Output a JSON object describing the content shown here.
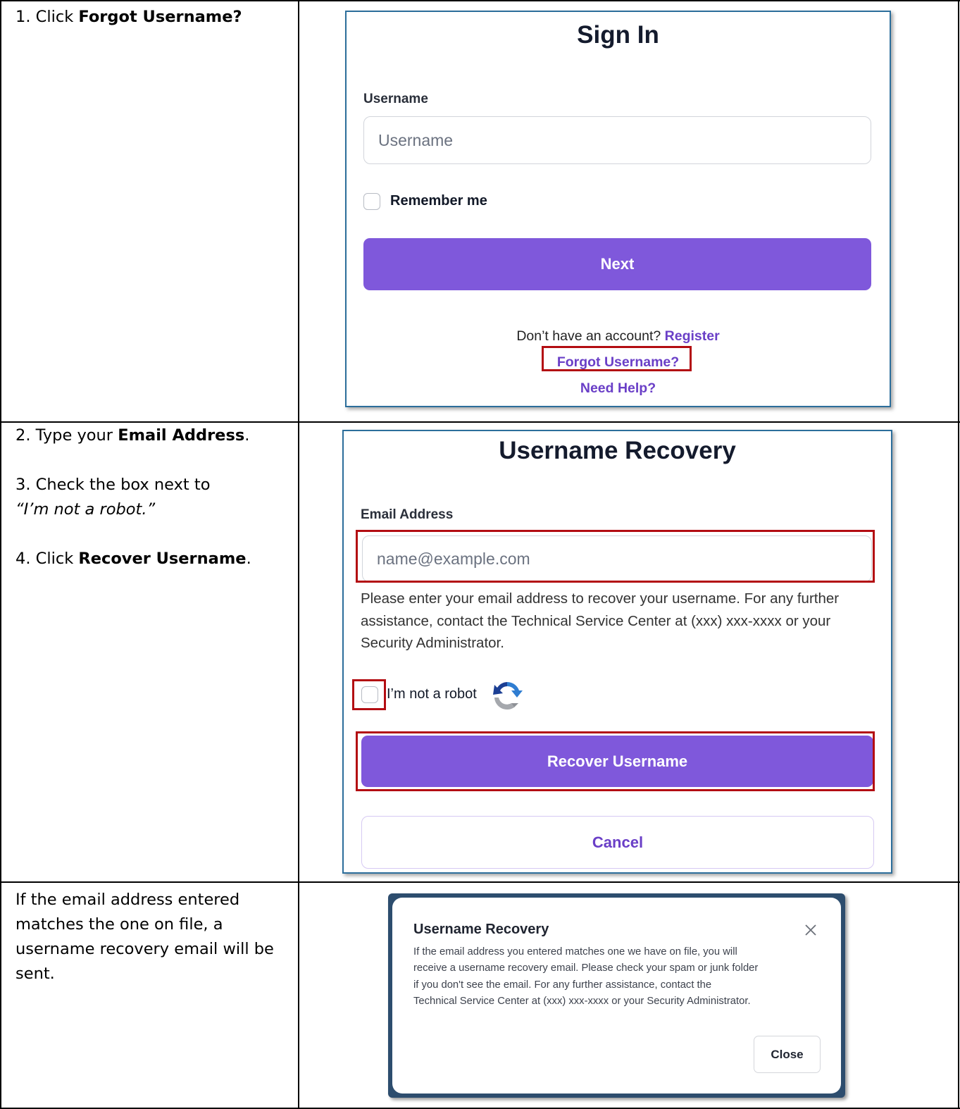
{
  "steps": {
    "step1": {
      "prefix": "1. Click ",
      "bold": "Forgot Username?"
    },
    "step2": {
      "prefix": "2. Type your ",
      "bold": "Email Address",
      "suffix": "."
    },
    "step3": {
      "line1": "3. Check the box next to",
      "line2": "“I’m not a robot.”"
    },
    "step4": {
      "prefix": "4. Click ",
      "bold": "Recover Username",
      "suffix": "."
    },
    "result": [
      "If the email address entered",
      "matches the one on file, a",
      "username recovery email will be",
      "sent."
    ]
  },
  "signin": {
    "title": "Sign In",
    "username_label": "Username",
    "username_placeholder": "Username",
    "remember_label": "Remember me",
    "next_label": "Next",
    "no_account_text": "Don’t have an account?",
    "register_link": "Register",
    "forgot_link": "Forgot Username?",
    "help_link": "Need Help?"
  },
  "recovery": {
    "title": "Username Recovery",
    "email_label": "Email Address",
    "email_placeholder": "name@example.com",
    "help_lines": [
      "Please enter your email address to recover your username. For any further",
      "assistance, contact the Technical Service Center at (xxx) xxx-xxxx or your",
      "Security Administrator."
    ],
    "robot_label": "I’m not a robot",
    "recover_label": "Recover Username",
    "cancel_label": "Cancel"
  },
  "dialog": {
    "title": "Username Recovery",
    "body_lines": [
      "If the email address you entered matches one we have on file, you will",
      "receive a username recovery email. Please check your spam or junk folder",
      "if you don't see the email. For any further assistance, contact the",
      "Technical Service Center at (xxx) xxx-xxxx or your Security Administrator."
    ],
    "close_label": "Close"
  },
  "colors": {
    "primary": "#7f58db",
    "link": "#6a3fc7",
    "highlight": "#b30d12",
    "panel_border": "#2c6e9b"
  }
}
